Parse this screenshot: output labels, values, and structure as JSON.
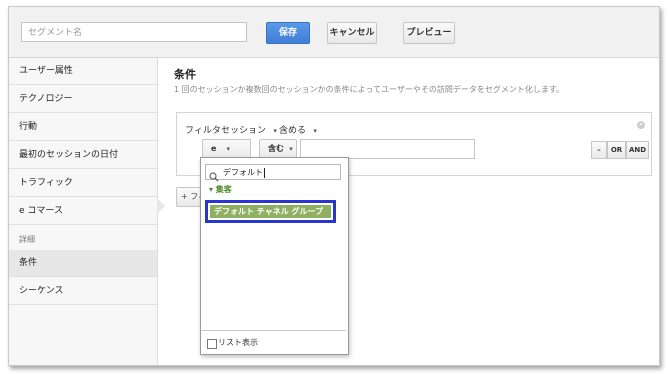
{
  "toolbar": {
    "segment_name_placeholder": "セグメント名",
    "save_label": "保存",
    "cancel_label": "キャンセル",
    "preview_label": "プレビュー"
  },
  "sidebar": {
    "items": [
      {
        "label": "ユーザー属性"
      },
      {
        "label": "テクノロジー"
      },
      {
        "label": "行動"
      },
      {
        "label": "最初のセッションの日付"
      },
      {
        "label": "トラフィック"
      },
      {
        "label": "e コマース"
      }
    ],
    "advanced_heading": "詳細",
    "advanced_items": [
      {
        "label": "条件",
        "active": true
      },
      {
        "label": "シーケンス"
      }
    ]
  },
  "main": {
    "title": "条件",
    "description": "1 回のセッションか複数回のセッションかの条件によってユーザーやその訪問データをセグメント化します。",
    "filter": {
      "filter_label": "フィルタ",
      "scope_value": "セッション",
      "include_value": "含める",
      "dimension_value": "e",
      "match_value": "含む",
      "condition_value": "",
      "op_remove": "–",
      "op_or": "OR",
      "op_and": "AND"
    },
    "add_filter_label": "+ フィ"
  },
  "dropdown": {
    "search_value": "デフォルト",
    "group_label": "▾ 集客",
    "option_label": "デフォルト チャネル グループ",
    "list_view_label": "リスト表示"
  },
  "colors": {
    "save_button": "#4a8ae0",
    "highlight_border": "#2a36c8",
    "option_bg": "#8faf62",
    "group_text": "#4e8a2c"
  }
}
